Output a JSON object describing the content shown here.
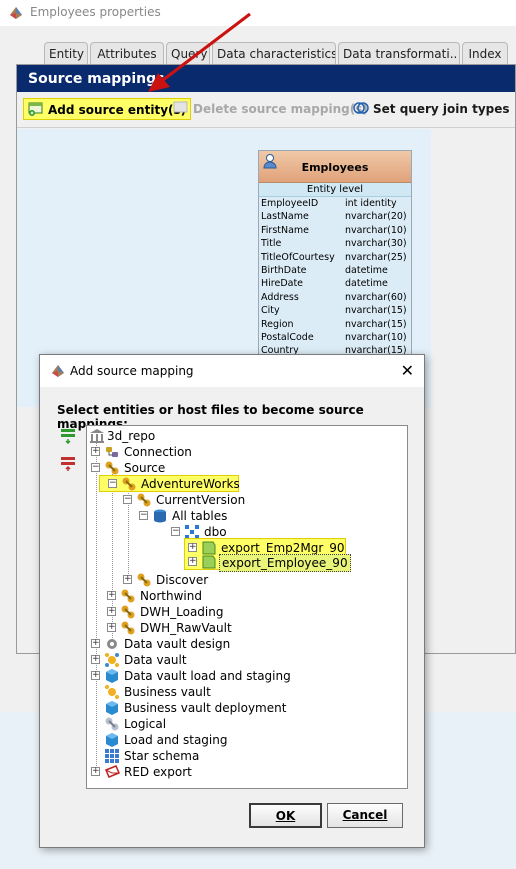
{
  "window": {
    "title": "Employees properties"
  },
  "tabs": [
    {
      "label": "Entity"
    },
    {
      "label": "Attributes"
    },
    {
      "label": "Query"
    },
    {
      "label": "Data characteristics"
    },
    {
      "label": "Data transformati.."
    },
    {
      "label": "Index"
    }
  ],
  "panel": {
    "title": "Source mappings",
    "toolbar": {
      "add_label": "Add source entity(s)",
      "delete_label": "Delete source mapping(s)",
      "join_label": "Set query join types"
    }
  },
  "entity": {
    "name": "Employees",
    "level": "Entity level",
    "columns": [
      {
        "name": "EmployeeID",
        "type": "int identity"
      },
      {
        "name": "LastName",
        "type": "nvarchar(20)"
      },
      {
        "name": "FirstName",
        "type": "nvarchar(10)"
      },
      {
        "name": "Title",
        "type": "nvarchar(30)"
      },
      {
        "name": "TitleOfCourtesy",
        "type": "nvarchar(25)"
      },
      {
        "name": "BirthDate",
        "type": "datetime"
      },
      {
        "name": "HireDate",
        "type": "datetime"
      },
      {
        "name": "Address",
        "type": "nvarchar(60)"
      },
      {
        "name": "City",
        "type": "nvarchar(15)"
      },
      {
        "name": "Region",
        "type": "nvarchar(15)"
      },
      {
        "name": "PostalCode",
        "type": "nvarchar(10)"
      },
      {
        "name": "Country",
        "type": "nvarchar(15)"
      }
    ]
  },
  "dialog": {
    "title": "Add source mapping",
    "prompt": "Select entities or host files to become source mappings:",
    "ok_label": "OK",
    "cancel_label": "Cancel",
    "tree": {
      "root": "3d_repo",
      "connection": "Connection",
      "source": "Source",
      "adventureworks": "AdventureWorks",
      "currentversion": "CurrentVersion",
      "alltables": "All tables",
      "dbo": "dbo",
      "export_emp2mgr": "export_Emp2Mgr_90",
      "export_employee": "export_Employee_90",
      "discover": "Discover",
      "northwind": "Northwind",
      "dwh_loading": "DWH_Loading",
      "dwh_rawvault": "DWH_RawVault",
      "dv_design": "Data vault design",
      "data_vault": "Data vault",
      "dv_load_staging": "Data vault load and staging",
      "business_vault": "Business vault",
      "bv_deployment": "Business vault deployment",
      "logical": "Logical",
      "load_staging": "Load and staging",
      "star_schema": "Star schema",
      "red_export": "RED export"
    }
  },
  "colors": {
    "header_bg": "#0a2a6e",
    "highlight": "#ffff66",
    "arrow": "#cc1111",
    "canvas_bg": "#e3f0fa"
  }
}
